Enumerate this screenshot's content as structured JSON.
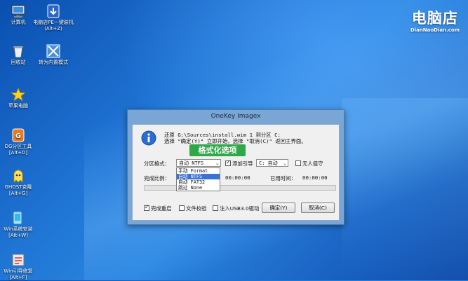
{
  "desktop": {
    "icons": [
      {
        "label": "计算机",
        "name": "computer-icon"
      },
      {
        "label": "电脑店PE一键装机(Alt+Z)",
        "name": "pe-install-icon"
      },
      {
        "label": "回收站",
        "name": "recycle-bin-icon"
      },
      {
        "label": "转为内置模式",
        "name": "builtin-mode-icon"
      },
      {
        "label": "苹果电脑",
        "name": "apple-icon"
      },
      {
        "label": "DG分区工具[Alt+D]",
        "name": "dg-partition-icon"
      },
      {
        "label": "GHOST克隆[Alt+G]",
        "name": "ghost-clone-icon"
      },
      {
        "label": "Win系统安装[Alt+W]",
        "name": "win-install-icon"
      },
      {
        "label": "Win引导修复[Alt+F]",
        "name": "boot-repair-icon"
      }
    ],
    "logo": {
      "main": "电脑店",
      "sub": "DianNaoDian.com"
    }
  },
  "dialog": {
    "title": "OneKey Imagex",
    "message_line1": "还原 G:\\Sources\\install.wim 1 到分区 C:",
    "message_line2": "选择 \"确定(Y)\" 立即开始，选择 \"取消(C)\" 返回主界面。",
    "format_label": "分区格式：",
    "format_value": "自动 NTFS",
    "format_options": [
      "手动 Format",
      "自动 NTFS",
      "自动 FAT32",
      "跳过 None"
    ],
    "selected_option_index": 1,
    "add_boot_label": "添加引导",
    "add_boot_checked": true,
    "boot_drive_value": "C: 自动",
    "no_info_label": "无人值守",
    "no_info_checked": false,
    "progress_label": "完成比例：",
    "progress_fraction": 0,
    "remaining_time": "00:00:00",
    "elapsed_label": "已用时间：",
    "elapsed_time": "00:00:00",
    "restart_label": "完成重启",
    "restart_checked": true,
    "verify_label": "文件校验",
    "verify_checked": false,
    "usb3_label": "注入USB3.0驱动",
    "usb3_checked": false,
    "ok_button": "确定(Y)",
    "cancel_button": "取消(C)"
  },
  "annotation": {
    "text": "格式化选项",
    "color": "#2fa84a"
  },
  "colors": {
    "desktop_accent": "#1f74d4",
    "selection": "#3a72d6"
  }
}
